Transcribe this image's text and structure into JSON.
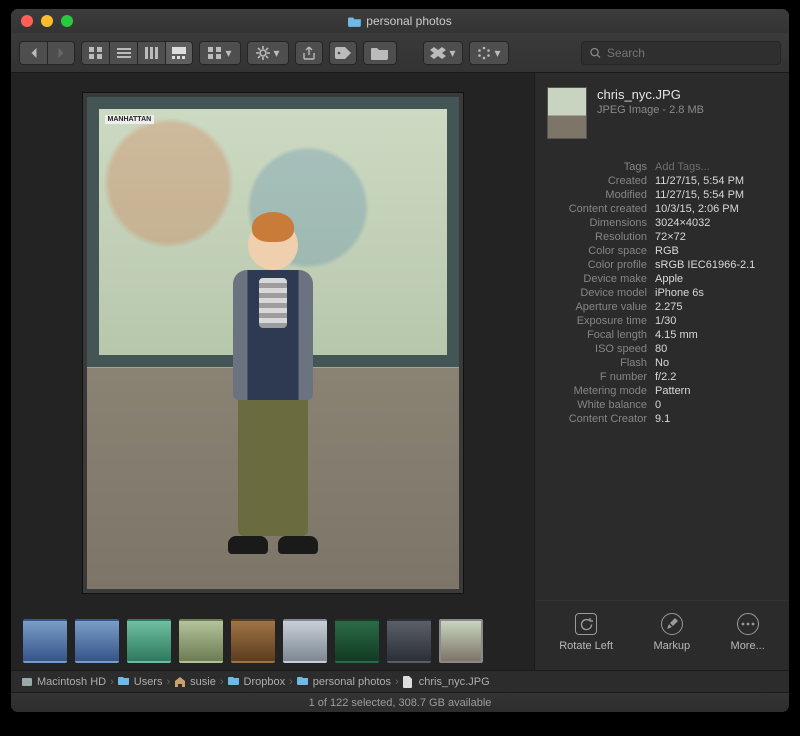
{
  "window": {
    "title": "personal photos"
  },
  "toolbar": {
    "search_placeholder": "Search"
  },
  "file": {
    "name": "chris_nyc.JPG",
    "kind_size": "JPEG Image - 2.8 MB"
  },
  "metadata": {
    "tags_label": "Tags",
    "tags_placeholder": "Add Tags...",
    "rows": [
      {
        "k": "Created",
        "v": "11/27/15, 5:54 PM"
      },
      {
        "k": "Modified",
        "v": "11/27/15, 5:54 PM"
      },
      {
        "k": "Content created",
        "v": "10/3/15, 2:06 PM"
      },
      {
        "k": "Dimensions",
        "v": "3024×4032"
      },
      {
        "k": "Resolution",
        "v": "72×72"
      },
      {
        "k": "Color space",
        "v": "RGB"
      },
      {
        "k": "Color profile",
        "v": "sRGB IEC61966-2.1"
      },
      {
        "k": "Device make",
        "v": "Apple"
      },
      {
        "k": "Device model",
        "v": "iPhone 6s"
      },
      {
        "k": "Aperture value",
        "v": "2.275"
      },
      {
        "k": "Exposure time",
        "v": "1/30"
      },
      {
        "k": "Focal length",
        "v": "4.15 mm"
      },
      {
        "k": "ISO speed",
        "v": "80"
      },
      {
        "k": "Flash",
        "v": "No"
      },
      {
        "k": "F number",
        "v": "f/2.2"
      },
      {
        "k": "Metering mode",
        "v": "Pattern"
      },
      {
        "k": "White balance",
        "v": "0"
      },
      {
        "k": "Content Creator",
        "v": "9.1"
      }
    ]
  },
  "actions": {
    "rotate_left": "Rotate Left",
    "markup": "Markup",
    "more": "More..."
  },
  "path": [
    {
      "icon": "disk",
      "label": "Macintosh HD"
    },
    {
      "icon": "folder",
      "label": "Users"
    },
    {
      "icon": "home",
      "label": "susie"
    },
    {
      "icon": "folder",
      "label": "Dropbox"
    },
    {
      "icon": "folder",
      "label": "personal photos"
    },
    {
      "icon": "file",
      "label": "chris_nyc.JPG"
    }
  ],
  "status": "1 of 122 selected, 308.7 GB available",
  "thumbnails": [
    {
      "bg": "linear-gradient(#7a9ec6,#36548a)"
    },
    {
      "bg": "linear-gradient(#7a9ec6,#36548a)"
    },
    {
      "bg": "linear-gradient(#6fbfa0,#2e7a60)"
    },
    {
      "bg": "linear-gradient(#b4c49a,#6d7c52)"
    },
    {
      "bg": "linear-gradient(#a07445,#5c3d1f)"
    },
    {
      "bg": "linear-gradient(#c9cfd6,#7d8893)"
    },
    {
      "bg": "linear-gradient(#2b6b46,#123a24)"
    },
    {
      "bg": "linear-gradient(#5b5f68,#2b2f38)"
    },
    {
      "bg": "linear-gradient(#c8d4bf,#7d7568)",
      "selected": true
    }
  ]
}
